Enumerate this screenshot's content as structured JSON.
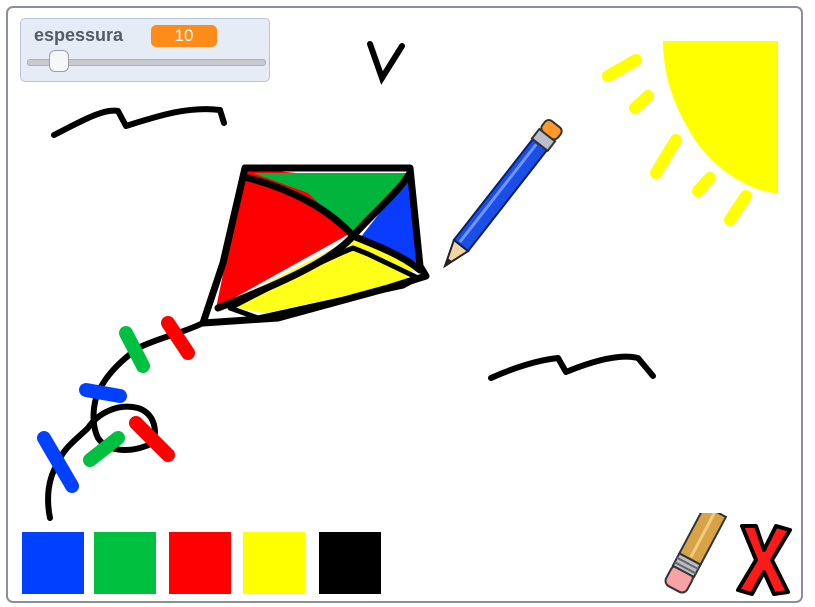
{
  "monitor": {
    "label": "espessura",
    "value": "10",
    "slider_fraction": 0.1
  },
  "palette": [
    {
      "name": "blue",
      "color": "#0040ff"
    },
    {
      "name": "green",
      "color": "#00c040"
    },
    {
      "name": "red",
      "color": "#ff0000"
    },
    {
      "name": "yellow",
      "color": "#ffff00"
    },
    {
      "name": "black",
      "color": "#000000"
    }
  ],
  "tools": {
    "pencil": "pencil-icon",
    "eraser": "eraser-icon",
    "clear": "red-x-icon"
  },
  "colors": {
    "kite_red": "#ff0000",
    "kite_green": "#00b43c",
    "kite_blue": "#0a3cff",
    "kite_yellow": "#ffff1a",
    "sun": "#ffff00",
    "pencil_body": "#1a4ee6",
    "pencil_tip": "#ff9a2a",
    "monitor_badge": "#ff8c1a"
  }
}
